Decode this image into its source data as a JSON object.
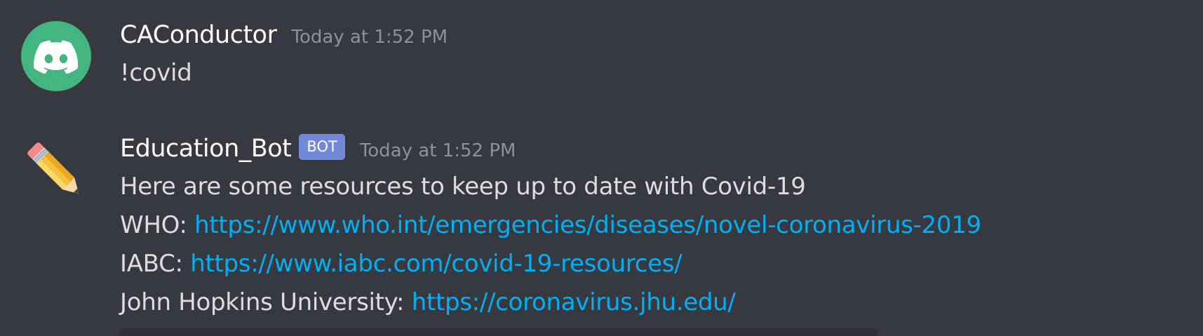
{
  "messages": [
    {
      "username": "CAConductor",
      "timestamp": "Today at 1:52 PM",
      "avatar_icon": "discord-logo-icon",
      "avatar_color": "#43b581",
      "content": "!covid"
    },
    {
      "username": "Education_Bot",
      "bot_tag": "BOT",
      "timestamp": "Today at 1:52 PM",
      "avatar_icon": "pencil-icon",
      "lines": [
        {
          "text": "Here are some resources to keep up to date with Covid-19"
        },
        {
          "label": "WHO: ",
          "link": "https://www.who.int/emergencies/diseases/novel-coronavirus-2019"
        },
        {
          "label": "IABC: ",
          "link": "https://www.iabc.com/covid-19-resources/"
        },
        {
          "label": "John Hopkins University: ",
          "link": "https://coronavirus.jhu.edu/"
        }
      ]
    }
  ],
  "colors": {
    "background": "#36393f",
    "username": "#ffffff",
    "timestamp": "#8e9297",
    "text": "#dcddde",
    "link": "#00aff4",
    "bot_tag": "#7289da",
    "embed": "#2f3136"
  }
}
